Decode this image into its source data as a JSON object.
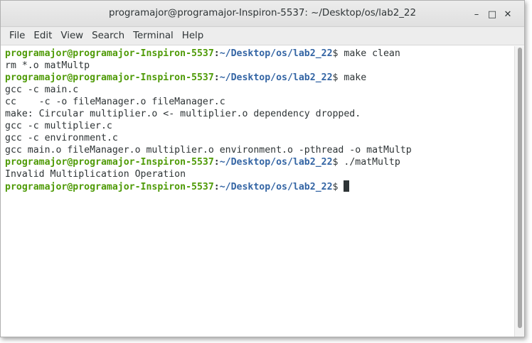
{
  "window": {
    "title": "programajor@programajor-Inspiron-5537: ~/Desktop/os/lab2_22",
    "minimize_glyph": "–",
    "maximize_glyph": "□",
    "close_glyph": "✕"
  },
  "menu": [
    "File",
    "Edit",
    "View",
    "Search",
    "Terminal",
    "Help"
  ],
  "prompt": {
    "user": "programajor@programajor-Inspiron-5537",
    "sep": ":",
    "path": "~/Desktop/os/lab2_22",
    "end": "$ "
  },
  "lines": [
    {
      "type": "prompt",
      "cmd": "make clean"
    },
    {
      "type": "output",
      "text": "rm *.o matMultp"
    },
    {
      "type": "prompt",
      "cmd": "make"
    },
    {
      "type": "output",
      "text": "gcc -c main.c"
    },
    {
      "type": "output",
      "text": "cc    -c -o fileManager.o fileManager.c"
    },
    {
      "type": "output",
      "text": "make: Circular multiplier.o <- multiplier.o dependency dropped."
    },
    {
      "type": "output",
      "text": "gcc -c multiplier.c"
    },
    {
      "type": "output",
      "text": "gcc -c environment.c"
    },
    {
      "type": "output",
      "text": "gcc main.o fileManager.o multiplier.o environment.o -pthread -o matMultp"
    },
    {
      "type": "prompt",
      "cmd": "./matMultp"
    },
    {
      "type": "output",
      "text": "Invalid Multiplication Operation"
    },
    {
      "type": "prompt",
      "cmd": "",
      "cursor": true
    }
  ],
  "colors": {
    "prompt_user": "#4e9a06",
    "prompt_path": "#3465a4",
    "text": "#2e3436"
  }
}
